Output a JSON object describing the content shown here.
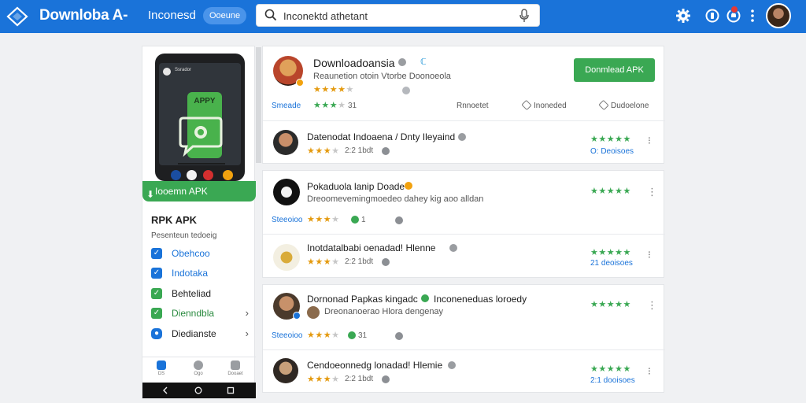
{
  "header": {
    "brand": "Downloba A-",
    "nav_title": "Inconesd",
    "nav_pill": "Ooeune",
    "search_value": "Inconektd athetant",
    "search_placeholder": "Search"
  },
  "left_panel": {
    "phone_title": "Ssrador",
    "app_card_label": "APPY",
    "download_button": "Iooemn APK",
    "heading": "RPK APK",
    "subheading": "Pesenteun tedoeig",
    "menu": [
      {
        "label": "Obehcoo",
        "color": "#1a73d9",
        "check_color": "#1a73d9",
        "chevron": false
      },
      {
        "label": "Indotaka",
        "color": "#1a73d9",
        "check_color": "#1a73d9",
        "chevron": false
      },
      {
        "label": "Behteliad",
        "color": "#222222",
        "check_color": "#3aa853",
        "chevron": false
      },
      {
        "label": "Dienndbla",
        "color": "#2a8a3f",
        "check_color": "#3aa853",
        "chevron": true
      },
      {
        "label": "Diedianste",
        "color": "#222222",
        "check_color": "#1a73d9",
        "chevron": true
      }
    ],
    "bottom_nav": [
      "DS",
      "Ogo",
      "Dooaet"
    ]
  },
  "featured": {
    "title": "Downloadoansia",
    "subtitle": "Reaunetion otoin  Vtorbe Doonoeola",
    "rating": 4,
    "download_button": "Donmlead APK",
    "rating_link": "Smeade",
    "rating_count": "31",
    "actions": [
      "Rnnoetet",
      "Inoneded",
      "Dudoelone"
    ]
  },
  "items": [
    {
      "title": "Datenodat Indoaena / Dnty Ileyaind",
      "subtitle": "",
      "rating": 3,
      "meta": "2:2 1bdt",
      "link": "",
      "reviews": "O: Deoisoes",
      "sub_stars": 0
    },
    {
      "title": "Pokaduola lanip Doade",
      "subtitle": "Dreoomevemingmoedeo dahey kig aoo alldan",
      "rating": 3,
      "meta": "1",
      "link": "Steeoioo",
      "reviews": "",
      "sub_stars": 0
    },
    {
      "title": "Inotdatalbabi oenadad! Hlenne",
      "subtitle": "",
      "rating": 3,
      "meta": "2:2 1bdt",
      "link": "",
      "reviews": "21 deoisoes",
      "sub_stars": 0
    },
    {
      "title": "Dornonad Papkas kingadc",
      "subtitle": "Dreonanoerao Hlora dengenay",
      "rating": 3,
      "meta": "31",
      "link": "Steeoioo",
      "reviews": "",
      "sub_stars": 0
    },
    {
      "title": "Cendoeonnedg lonadad! Hlemie",
      "subtitle": "",
      "rating": 3,
      "meta": "2:2 1bdt",
      "link": "",
      "reviews": "2:1 dooisoes",
      "sub_stars": 0
    },
    {
      "title": "Inconeneduas loroedy",
      "subtitle": "",
      "rating": 0,
      "meta": "",
      "link": "",
      "reviews": "",
      "sub_stars": 0
    }
  ],
  "colors": {
    "brand_blue": "#1a73d9",
    "green": "#3aa853",
    "star_orange": "#e49a0f"
  },
  "icons": [
    "logo-icon",
    "search-icon",
    "mic-icon",
    "settings-icon",
    "help-icon",
    "notifications-icon",
    "more-icon",
    "avatar",
    "checkbox-icon",
    "chevron-right-icon",
    "kebab-icon",
    "verified-icon",
    "share-icon",
    "bookmark-icon",
    "back-icon",
    "home-icon",
    "recents-icon"
  ]
}
